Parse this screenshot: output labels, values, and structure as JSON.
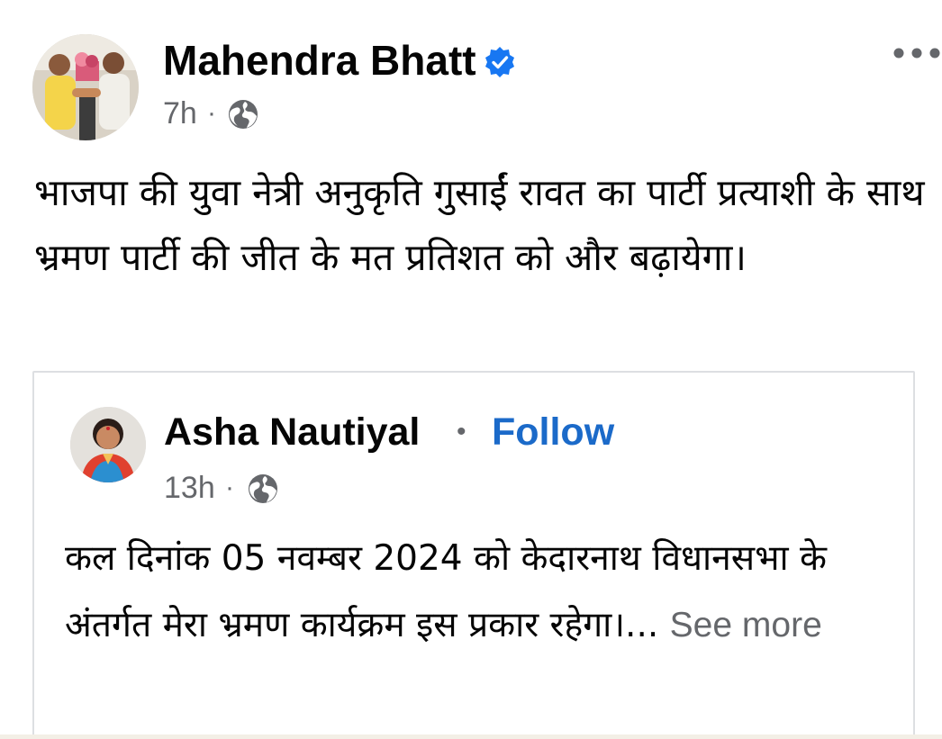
{
  "post": {
    "author": "Mahendra Bhatt",
    "verified_icon": "verified-badge-icon",
    "time": "7h",
    "separator": "·",
    "privacy_icon": "globe-icon",
    "more_icon": "more-options-icon",
    "text": "भाजपा की युवा नेत्री अनुकृति गुसाईं रावत का पार्टी प्रत्याशी के साथ भ्रमण पार्टी की जीत के मत प्रतिशत को और बढ़ायेगा।"
  },
  "shared_post": {
    "author": "Asha Nautiyal",
    "separator": "•",
    "follow_label": "Follow",
    "time": "13h",
    "time_separator": "·",
    "privacy_icon": "globe-icon",
    "text": "कल दिनांक 05 नवम्बर 2024 को केदारनाथ विधानसभा के अंतर्गत मेरा भ्रमण कार्यक्रम इस प्रकार रहेगा।...",
    "see_more_label": "See more"
  },
  "colors": {
    "accent": "#1b6ac9",
    "verified": "#1877f2",
    "meta_gray": "#65676b",
    "text": "#050505",
    "border": "#dddfe2"
  }
}
